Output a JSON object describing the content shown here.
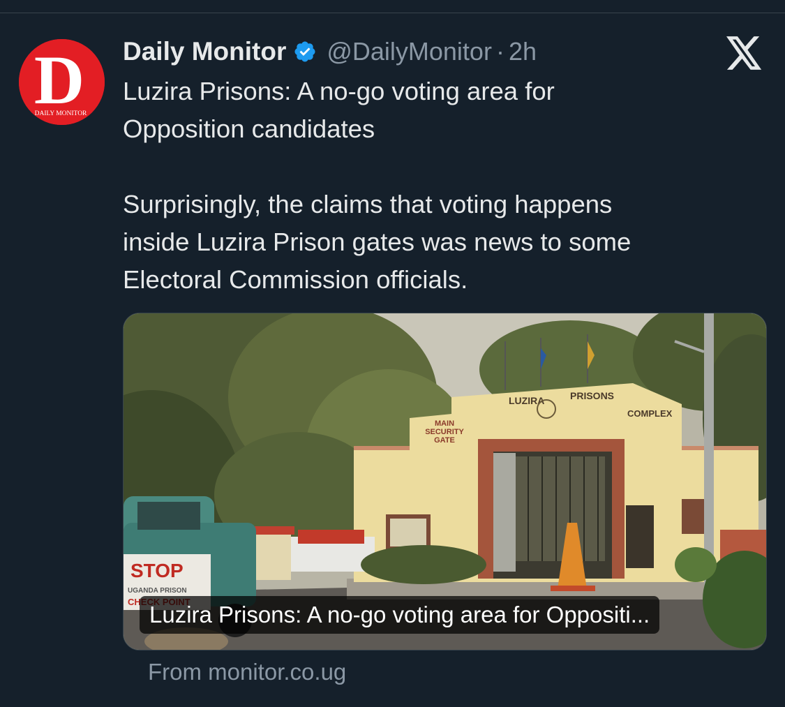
{
  "tweet": {
    "author_name": "Daily Monitor",
    "handle": "@DailyMonitor",
    "separator": "·",
    "time": "2h",
    "text": "Luzira Prisons: A no-go voting area for\nOpposition candidates\n\nSurprisingly, the claims that voting happens\ninside Luzira Prison gates was news to some\nElectoral Commission officials."
  },
  "avatar": {
    "logo_letter": "D",
    "logo_text": "DAILY MONITOR",
    "brand_color": "#e31e24"
  },
  "card": {
    "caption": "Luzira Prisons: A no-go voting area for Oppositi...",
    "source": "From monitor.co.ug",
    "photo_signs": {
      "arch_left": "LUZIRA",
      "arch_right": "PRISONS",
      "arch_complex": "COMPLEX",
      "gate_sign_1": "MAIN",
      "gate_sign_2": "SECURITY",
      "gate_sign_3": "GATE",
      "stop_sign": "STOP",
      "stop_sub_1": "UGANDA PRISON",
      "stop_sub_2": "CHECK POINT"
    }
  },
  "icons": {
    "verified": "verified-badge-icon",
    "platform": "x-logo-icon"
  },
  "colors": {
    "background": "#15202b",
    "text_primary": "#e7e9ea",
    "text_secondary": "#8b98a5",
    "verified_blue": "#1d9bf0",
    "border": "#38444d"
  }
}
